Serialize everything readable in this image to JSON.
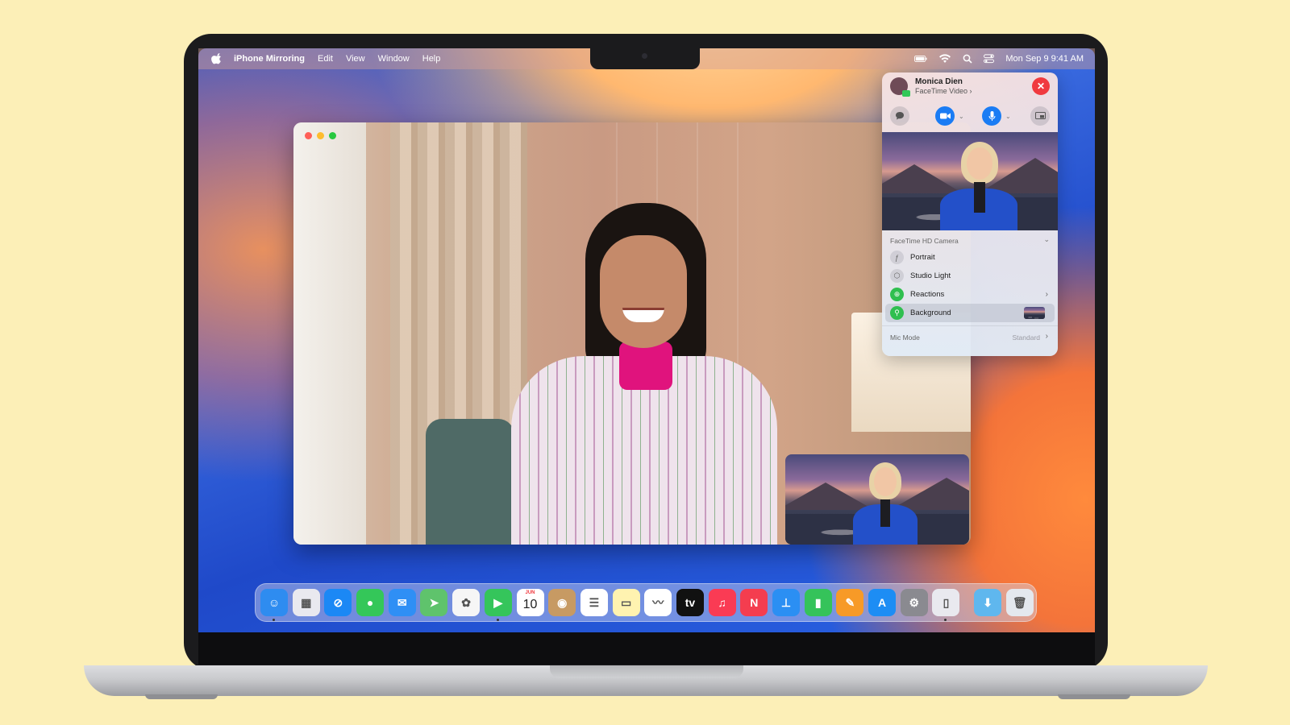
{
  "menubar": {
    "app_name": "iPhone Mirroring",
    "items": [
      "Edit",
      "View",
      "Window",
      "Help"
    ],
    "clock": "Mon Sep 9  9:41 AM"
  },
  "call_panel": {
    "contact_name": "Monica Dien",
    "call_type": "FaceTime Video",
    "call_type_chevron": "›",
    "close_glyph": "✕",
    "camera_section": "FaceTime HD Camera",
    "section_chevron": "⌄",
    "options": [
      {
        "label": "Portrait",
        "icon": "f-aperture-icon",
        "glyph": "ƒ",
        "style": "grey"
      },
      {
        "label": "Studio Light",
        "icon": "cube-icon",
        "glyph": "⬡",
        "style": "grey"
      },
      {
        "label": "Reactions",
        "icon": "reactions-icon",
        "glyph": "⊕",
        "style": "green",
        "chevron": "›"
      },
      {
        "label": "Background",
        "icon": "person-icon",
        "glyph": "⚲",
        "style": "green",
        "selected": true
      }
    ],
    "mic_mode_label": "Mic Mode",
    "mic_mode_value": "Standard",
    "mic_mode_chevron": "›"
  },
  "dock": {
    "apps": [
      {
        "name": "Finder",
        "icon": "finder-icon",
        "color": "#2e8cf0",
        "glyph": "☺",
        "running": true
      },
      {
        "name": "Launchpad",
        "icon": "launchpad-icon",
        "color": "#e9e9ef",
        "glyph": "▦"
      },
      {
        "name": "Safari",
        "icon": "safari-icon",
        "color": "#1b88f5",
        "glyph": "⊘"
      },
      {
        "name": "Messages",
        "icon": "messages-icon",
        "color": "#34c759",
        "glyph": "●"
      },
      {
        "name": "Mail",
        "icon": "mail-icon",
        "color": "#2f8ff5",
        "glyph": "✉"
      },
      {
        "name": "Maps",
        "icon": "maps-icon",
        "color": "#5fc36c",
        "glyph": "➤"
      },
      {
        "name": "Photos",
        "icon": "photos-icon",
        "color": "#f6f6f6",
        "glyph": "✿"
      },
      {
        "name": "FaceTime",
        "icon": "facetime-icon",
        "color": "#35c55b",
        "glyph": "▶",
        "running": true
      },
      {
        "name": "Calendar",
        "icon": "calendar-icon",
        "color": "#ffffff",
        "calendar": {
          "month": "JUN",
          "day": "10"
        }
      },
      {
        "name": "Contacts",
        "icon": "contacts-icon",
        "color": "#c79a63",
        "glyph": "◉"
      },
      {
        "name": "Reminders",
        "icon": "reminders-icon",
        "color": "#ffffff",
        "glyph": "☰"
      },
      {
        "name": "Notes",
        "icon": "notes-icon",
        "color": "#fff3b0",
        "glyph": "▭"
      },
      {
        "name": "Freeform",
        "icon": "freeform-icon",
        "color": "#ffffff",
        "glyph": "〰"
      },
      {
        "name": "TV",
        "icon": "tv-icon",
        "color": "#111111",
        "glyph": "tv"
      },
      {
        "name": "Music",
        "icon": "music-icon",
        "color": "#fa3b54",
        "glyph": "♫"
      },
      {
        "name": "News",
        "icon": "news-icon",
        "color": "#f43d4f",
        "glyph": "N"
      },
      {
        "name": "Keynote",
        "icon": "keynote-icon",
        "color": "#2b8ff3",
        "glyph": "⊥"
      },
      {
        "name": "Numbers",
        "icon": "numbers-icon",
        "color": "#35c35a",
        "glyph": "▮"
      },
      {
        "name": "Pages",
        "icon": "pages-icon",
        "color": "#f79a27",
        "glyph": "✎"
      },
      {
        "name": "App Store",
        "icon": "app-store-icon",
        "color": "#1d8df4",
        "glyph": "A"
      },
      {
        "name": "System Settings",
        "icon": "gear-icon",
        "color": "#8a8a90",
        "glyph": "⚙"
      },
      {
        "name": "iPhone Mirroring",
        "icon": "iphone-icon",
        "color": "#e9e9ef",
        "glyph": "▯",
        "running": true
      }
    ],
    "folders": [
      {
        "name": "Downloads",
        "icon": "downloads-folder-icon",
        "color": "#5fb7ee",
        "glyph": "⬇"
      },
      {
        "name": "Trash",
        "icon": "trash-icon",
        "color": "#e4e8ee",
        "glyph": "🗑"
      }
    ]
  }
}
